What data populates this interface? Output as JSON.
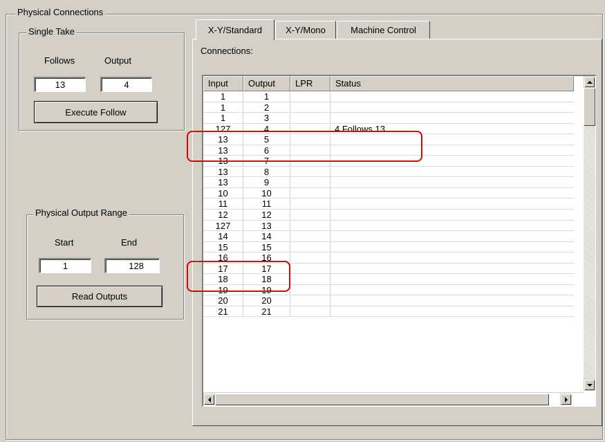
{
  "physical_connections": {
    "title": "Physical Connections"
  },
  "single_take": {
    "title": "Single Take",
    "follows_label": "Follows",
    "output_label": "Output",
    "follows_value": "13",
    "output_value": "4",
    "execute_label": "Execute Follow"
  },
  "output_range": {
    "title": "Physical Output Range",
    "start_label": "Start",
    "end_label": "End",
    "start_value": "1",
    "end_value": "128",
    "read_label": "Read Outputs"
  },
  "tabs": [
    {
      "label": "X-Y/Standard",
      "active": true
    },
    {
      "label": "X-Y/Mono",
      "active": false
    },
    {
      "label": "Machine Control",
      "active": false
    }
  ],
  "connections_label": "Connections:",
  "table": {
    "columns": [
      "Input",
      "Output",
      "LPR",
      "Status"
    ],
    "rows": [
      [
        "1",
        "1",
        "",
        ""
      ],
      [
        "1",
        "2",
        "",
        ""
      ],
      [
        "1",
        "3",
        "",
        ""
      ],
      [
        "127",
        "4",
        "",
        "4 Follows 13"
      ],
      [
        "13",
        "5",
        "",
        ""
      ],
      [
        "13",
        "6",
        "",
        ""
      ],
      [
        "13",
        "7",
        "",
        ""
      ],
      [
        "13",
        "8",
        "",
        ""
      ],
      [
        "13",
        "9",
        "",
        ""
      ],
      [
        "10",
        "10",
        "",
        ""
      ],
      [
        "11",
        "11",
        "",
        ""
      ],
      [
        "12",
        "12",
        "",
        ""
      ],
      [
        "127",
        "13",
        "",
        ""
      ],
      [
        "14",
        "14",
        "",
        ""
      ],
      [
        "15",
        "15",
        "",
        ""
      ],
      [
        "16",
        "16",
        "",
        ""
      ],
      [
        "17",
        "17",
        "",
        ""
      ],
      [
        "18",
        "18",
        "",
        ""
      ],
      [
        "19",
        "19",
        "",
        ""
      ],
      [
        "20",
        "20",
        "",
        ""
      ],
      [
        "21",
        "21",
        "",
        ""
      ]
    ]
  },
  "annotation_color": "#e00000"
}
